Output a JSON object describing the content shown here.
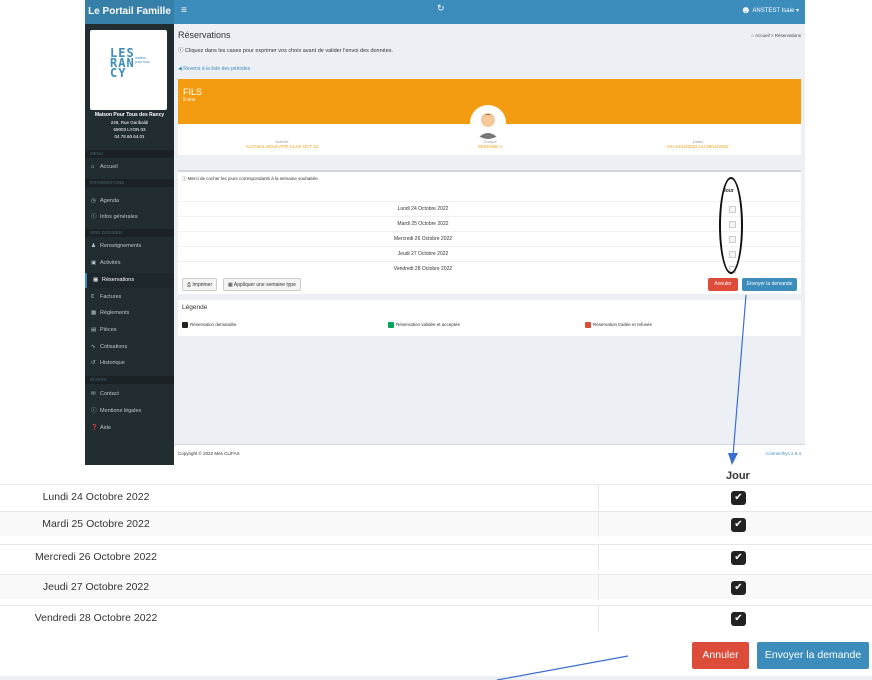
{
  "colors": {
    "primary": "#3c8dbc",
    "danger": "#dd4b39",
    "warning": "#f39c12",
    "success": "#00a65a",
    "sidebar": "#222d32"
  },
  "app": {
    "brand": "Le Portail Famille",
    "user": "ANSTEST Isaie"
  },
  "sidebar": {
    "logo_text": "LESRANCY",
    "logo_sub": "maison pour tous",
    "org_name": "Maison Pour Tous des Rancy",
    "org_address": "249, Rue Garibaldi",
    "org_city": "69003 LYON 03",
    "org_phone": "04.78.60.64.01",
    "sections": [
      {
        "label": "MENU"
      },
      {
        "label": "INFORMATIONS"
      },
      {
        "label": "MON DOSSIER"
      },
      {
        "label": "DIVERS"
      }
    ],
    "items": [
      {
        "label": "Accueil",
        "icon": "home-icon"
      },
      {
        "label": "Agenda",
        "icon": "clock-icon"
      },
      {
        "label": "Infos générales",
        "icon": "info-icon"
      },
      {
        "label": "Renseignements",
        "icon": "user-icon"
      },
      {
        "label": "Activités",
        "icon": "cubes-icon"
      },
      {
        "label": "Réservations",
        "icon": "calendar-icon"
      },
      {
        "label": "Factures",
        "icon": "euro-icon"
      },
      {
        "label": "Règlements",
        "icon": "money-icon"
      },
      {
        "label": "Pièces",
        "icon": "file-icon"
      },
      {
        "label": "Cotisations",
        "icon": "tag-icon"
      },
      {
        "label": "Historique",
        "icon": "history-icon"
      },
      {
        "label": "Contact",
        "icon": "envelope-icon"
      },
      {
        "label": "Mentions légales",
        "icon": "info-icon"
      },
      {
        "label": "Aide",
        "icon": "help-icon"
      }
    ]
  },
  "page": {
    "title": "Réservations",
    "breadcrumb_home": "Accueil",
    "breadcrumb_current": "Réservations",
    "info": "Cliquez dans les cases pour exprimer vos choix avant de valider l'envoi des données.",
    "back_link": "Revenir à la liste des périodes"
  },
  "child": {
    "name": "FILS",
    "age": "9 ans",
    "activity_label": "Activité",
    "activity_value": "ACCUEIL EDUCATIF CLAS OCT 22",
    "group_label": "Groupe",
    "group_value": "SEMAINE 1",
    "period_label": "Dates",
    "period_value": "DU 24/10/2022 AU 28/10/2022"
  },
  "reservations": {
    "note": "Merci de cocher les jours correspondants à la semaine souhaitée.",
    "column_header": "Jour",
    "column_header_zoom": "Jour",
    "rows": [
      {
        "date": "Lundi 24 Octobre 2022",
        "checked": true
      },
      {
        "date": "Mardi 25 Octobre 2022",
        "checked": true
      },
      {
        "date": "Mercredi 26 Octobre 2022",
        "checked": true
      },
      {
        "date": "Jeudi 27 Octobre 2022",
        "checked": true
      },
      {
        "date": "Vendredi 28 Octobre 2022",
        "checked": true
      }
    ],
    "print_label": "Imprimer",
    "apply_week_label": "Appliquer une semaine type",
    "cancel_label": "Annuler",
    "send_label": "Envoyer la demande"
  },
  "legend": {
    "title": "Légende",
    "items": [
      {
        "label": "Réservation demandée",
        "color": "#222222"
      },
      {
        "label": "Réservation validée et acceptée",
        "color": "#00a65a"
      },
      {
        "label": "Réservation traitée et refusée",
        "color": "#dd4b39"
      }
    ]
  },
  "footer": {
    "copyright": "Copyright © 2022 Mes CLIFAS",
    "version": "Connecthys 2.9.4"
  }
}
